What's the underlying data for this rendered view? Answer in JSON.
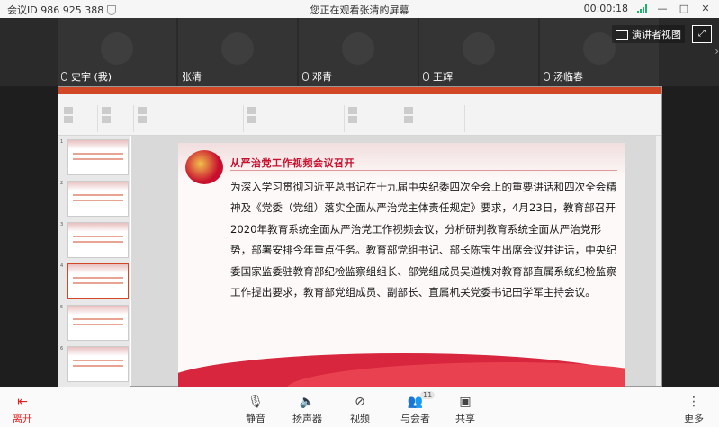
{
  "topbar": {
    "meeting_id": "会议ID 986 925 388",
    "viewing": "您正在观看张清的屏幕",
    "timer": "00:00:18"
  },
  "participants": [
    {
      "name": "史宇 (我)"
    },
    {
      "name": "张清"
    },
    {
      "name": "邓青"
    },
    {
      "name": "王辉"
    },
    {
      "name": "汤临春"
    }
  ],
  "view_controls": {
    "presenter_view": "演讲者视图"
  },
  "slide": {
    "title": "从严治党工作视频会议召开",
    "body": "为深入学习贯彻习近平总书记在十九届中央纪委四次全会上的重要讲话和四次全会精神及《党委（党组）落实全面从严治党主体责任规定》要求，4月23日，教育部召开2020年教育系统全面从严治党工作视频会议，分析研判教育系统全面从严治党形势，部署安排今年重点任务。教育部党组书记、部长陈宝生出席会议并讲话，中央纪委国家监委驻教育部纪检监察组组长、部党组成员吴道槐对教育部直属系统纪检监察工作提出要求，教育部党组成员、副部长、直属机关党委书记田学军主持会议。"
  },
  "toolbar": {
    "leave": "离开",
    "mute": "静音",
    "speaker": "扬声器",
    "video": "视频",
    "participants": "与会者",
    "participants_count": "11",
    "share": "共享",
    "more": "更多"
  },
  "colors": {
    "leave_red": "#e02424",
    "slide_title_red": "#c8102e",
    "ppt_orange": "#d24726"
  }
}
